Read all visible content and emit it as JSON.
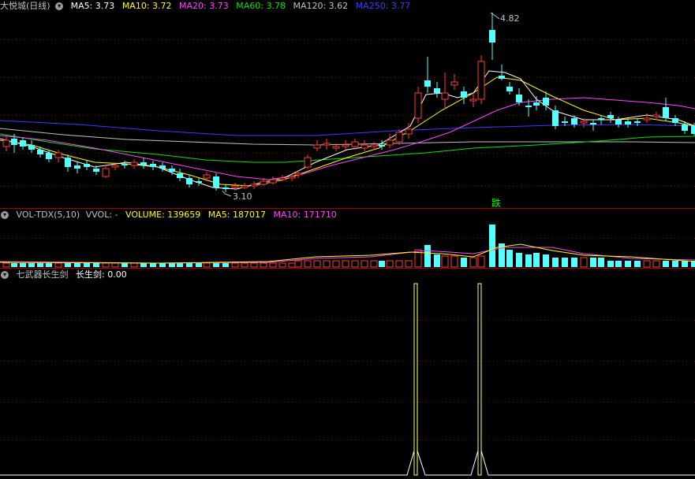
{
  "colors": {
    "up": "#ff3c3c",
    "down": "#54ffff",
    "ma5": "#ffffff",
    "ma10": "#ffff00",
    "ma20": "#ff44ff",
    "ma60": "#00e600",
    "ma120": "#c0c0c0",
    "ma250": "#3c3cff",
    "grid": "#7f0000",
    "signal": "#ffff70"
  },
  "price_panel": {
    "title": "大悦城(日线)",
    "collapse_icon": "chevron-down-icon",
    "ma": [
      {
        "key": "ma5",
        "label": "MA5: 3.73"
      },
      {
        "key": "ma10",
        "label": "MA10: 3.72"
      },
      {
        "key": "ma20",
        "label": "MA20: 3.73"
      },
      {
        "key": "ma60",
        "label": "MA60: 3.78"
      },
      {
        "key": "ma120",
        "label": "MA120: 3.62"
      },
      {
        "key": "ma250",
        "label": "MA250: 3.77"
      }
    ],
    "high_label": "4.82",
    "low_label": "3.10",
    "badge": "跌"
  },
  "volume_panel": {
    "title": "VOL-TDX(5,10)",
    "vvol": "VVOL: -",
    "volume": "VOLUME: 139659",
    "ma5": "MA5: 187017",
    "ma10": "MA10: 171710"
  },
  "indicator_panel": {
    "title": "七武器长生剑",
    "value": "长生剑: 0.00"
  }
}
